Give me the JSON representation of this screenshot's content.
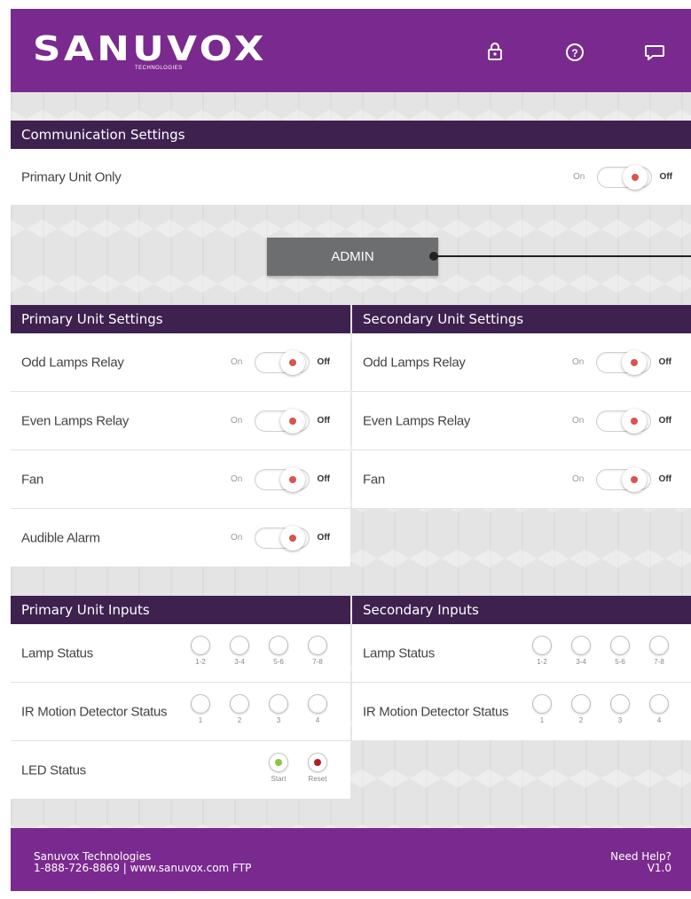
{
  "brand": {
    "logo": "SANUVOX",
    "logo_sub": "TECHNOLOGIES",
    "purple": "#7a2a8f",
    "dark_purple": "#3f2150"
  },
  "header_icons": [
    "lock-icon",
    "help-icon",
    "chat-icon"
  ],
  "communication": {
    "title": "Communication Settings",
    "primary_only": {
      "label": "Primary Unit Only",
      "on": "On",
      "off": "Off",
      "state": "Off"
    }
  },
  "admin": {
    "label": "ADMIN"
  },
  "primary_settings": {
    "title": "Primary Unit Settings",
    "rows": [
      {
        "label": "Odd Lamps Relay",
        "on": "On",
        "off": "Off",
        "state": "Off"
      },
      {
        "label": "Even Lamps Relay",
        "on": "On",
        "off": "Off",
        "state": "Off"
      },
      {
        "label": "Fan",
        "on": "On",
        "off": "Off",
        "state": "Off"
      },
      {
        "label": "Audible Alarm",
        "on": "On",
        "off": "Off",
        "state": "Off"
      }
    ]
  },
  "secondary_settings": {
    "title": "Secondary Unit Settings",
    "rows": [
      {
        "label": "Odd Lamps Relay",
        "on": "On",
        "off": "Off",
        "state": "Off"
      },
      {
        "label": "Even Lamps Relay",
        "on": "On",
        "off": "Off",
        "state": "Off"
      },
      {
        "label": "Fan",
        "on": "On",
        "off": "Off",
        "state": "Off"
      }
    ]
  },
  "primary_inputs": {
    "title": "Primary Unit Inputs",
    "lamp_status": {
      "label": "Lamp Status",
      "indicators": [
        "1-2",
        "3-4",
        "5-6",
        "7-8"
      ]
    },
    "ir_status": {
      "label": "IR Motion Detector Status",
      "indicators": [
        "1",
        "2",
        "3",
        "4"
      ]
    },
    "led_status": {
      "label": "LED Status",
      "start": "Start",
      "reset": "Reset",
      "start_color": "#8cc63f",
      "reset_color": "#b0202a"
    }
  },
  "secondary_inputs": {
    "title": "Secondary Inputs",
    "lamp_status": {
      "label": "Lamp Status",
      "indicators": [
        "1-2",
        "3-4",
        "5-6",
        "7-8"
      ]
    },
    "ir_status": {
      "label": "IR Motion Detector Status",
      "indicators": [
        "1",
        "2",
        "3",
        "4"
      ]
    }
  },
  "footer": {
    "company": "Sanuvox Technologies",
    "contact": "1-888-726-8869 | www.sanuvox.com FTP",
    "help": "Need Help?",
    "version": "V1.0"
  }
}
